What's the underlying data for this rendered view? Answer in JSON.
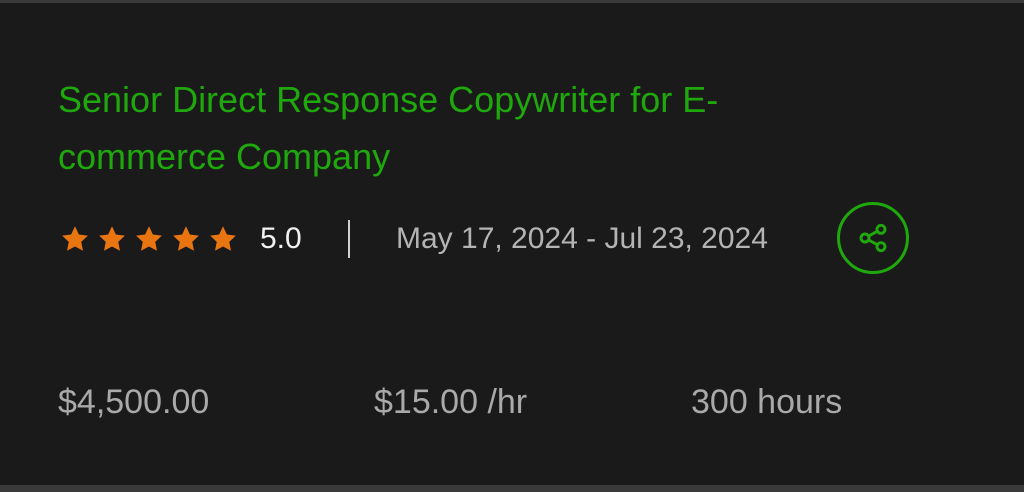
{
  "job": {
    "title": "Senior Direct Response Copywriter for E-commerce Company",
    "rating": {
      "value": 5.0,
      "label": "5.0",
      "stars_filled": 5,
      "stars_total": 5,
      "star_color": "#e8750f"
    },
    "date_range": "May 17, 2024 - Jul 23, 2024",
    "share_icon": "share-icon",
    "accent_color": "#1fa80c"
  },
  "stats": {
    "budget": "$4,500.00",
    "rate": "$15.00 /hr",
    "hours": "300 hours"
  }
}
